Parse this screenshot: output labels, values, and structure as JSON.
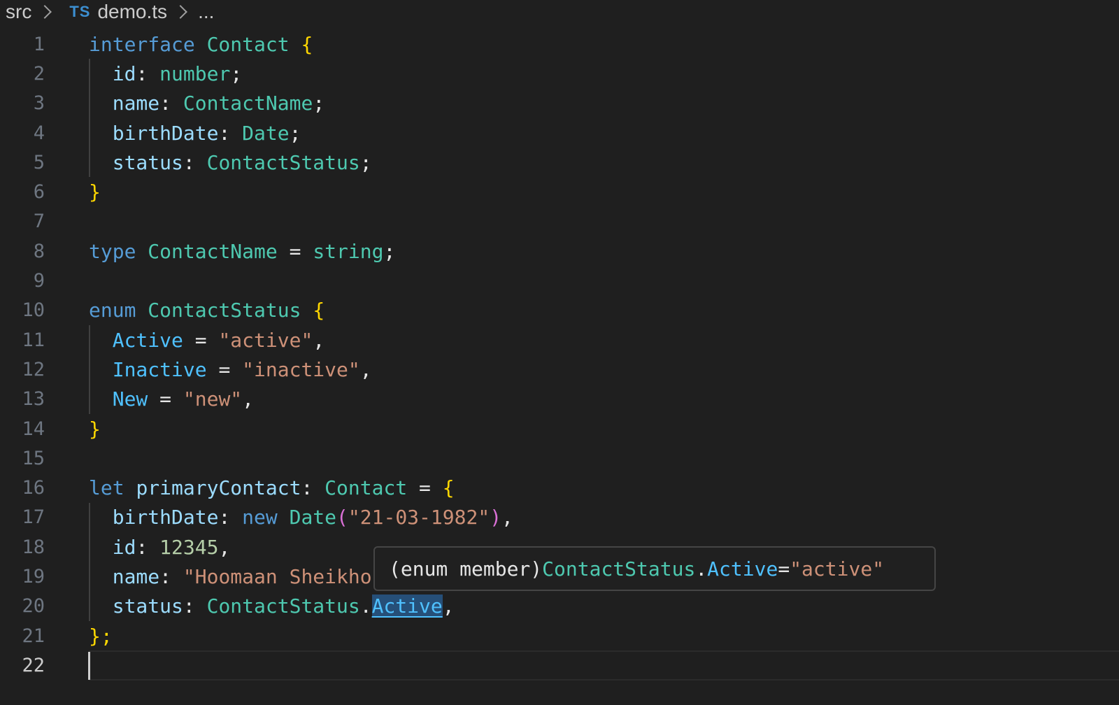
{
  "breadcrumb": {
    "folder": "src",
    "lang_icon": "TS",
    "file": "demo.ts",
    "more": "..."
  },
  "editor": {
    "line_numbers": [
      "1",
      "2",
      "3",
      "4",
      "5",
      "6",
      "7",
      "8",
      "9",
      "10",
      "11",
      "12",
      "13",
      "14",
      "15",
      "16",
      "17",
      "18",
      "19",
      "20",
      "21",
      "22"
    ],
    "active_line": 22,
    "tokens": {
      "kw_interface": "interface",
      "contact": "Contact",
      "ob": "{",
      "cb": "}",
      "id": "id",
      "colon": ":",
      "number": "number",
      "semi": ";",
      "name": "name",
      "contact_name": "ContactName",
      "birth_date": "birthDate",
      "date": "Date",
      "status": "status",
      "contact_status": "ContactStatus",
      "kw_type": "type",
      "eq": "=",
      "string": "string",
      "kw_enum": "enum",
      "active": "Active",
      "active_str": "\"active\"",
      "comma": ",",
      "inactive": "Inactive",
      "inactive_str": "\"inactive\"",
      "new_member": "New",
      "new_str": "\"new\"",
      "kw_let": "let",
      "primary_contact": "primaryContact",
      "kw_new": "new",
      "op": "(",
      "cp": ")",
      "date_str": "\"21-03-1982\"",
      "id_val": "12345",
      "name_str": "\"Hoomaan Sheikho",
      "dot": ".",
      "end": "};"
    }
  },
  "hover": {
    "prefix": "(enum member)",
    "enum_name": "ContactStatus",
    "dot": ".",
    "member": "Active",
    "eq": "=",
    "value": "\"active\""
  }
}
